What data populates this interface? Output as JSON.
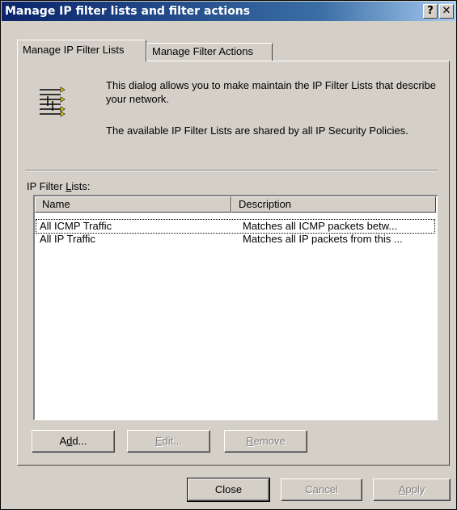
{
  "window": {
    "title": "Manage IP filter lists and filter actions",
    "help_glyph": "?",
    "close_glyph": "✕"
  },
  "tabs": [
    {
      "label": "Manage IP Filter Lists",
      "active": true
    },
    {
      "label": "Manage Filter Actions",
      "active": false
    }
  ],
  "info": {
    "icon": "filter-list-icon",
    "line1": "This dialog allows you to make maintain the IP Filter Lists that describe your network.",
    "line2": "The available IP Filter Lists are shared by all IP Security Policies."
  },
  "list": {
    "label_pre": "IP Filter ",
    "label_accel": "L",
    "label_post": "ists:",
    "columns": [
      "Name",
      "Description"
    ],
    "rows": [
      {
        "name": "All ICMP Traffic",
        "description": "Matches all ICMP packets betw..."
      },
      {
        "name": "All IP Traffic",
        "description": "Matches all IP packets from this ..."
      }
    ]
  },
  "buttons": {
    "add": {
      "pre": "A",
      "accel": "d",
      "post": "d..."
    },
    "edit": {
      "pre": "",
      "accel": "E",
      "post": "dit..."
    },
    "remove": {
      "pre": "",
      "accel": "R",
      "post": "emove"
    },
    "close": "Close",
    "cancel": "Cancel",
    "apply": {
      "pre": "",
      "accel": "A",
      "post": "pply"
    }
  },
  "colors": {
    "dialog_bg": "#d4d0c8",
    "title_bg": "#0a246a",
    "disabled_text": "#808080"
  }
}
